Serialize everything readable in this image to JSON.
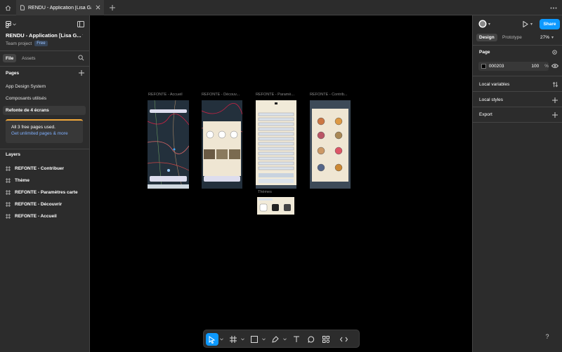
{
  "colors": {
    "accent": "#0d99ff",
    "panel": "#2c2c2c",
    "canvas": "#000000",
    "upsell_bar": "#f2a93b",
    "link": "#7fb0ff"
  },
  "tab": {
    "title": "RENDU - Application [Lisa Gadea]"
  },
  "left_panel": {
    "project_title": "RENDU - Application [Lisa G...",
    "team": "Team project",
    "plan_badge": "Free",
    "tabs": {
      "file": "File",
      "assets": "Assets"
    },
    "pages_heading": "Pages",
    "pages": [
      {
        "label": "App Design System"
      },
      {
        "label": "Composants utilisés"
      },
      {
        "label": "Refonte de 4 écrans"
      }
    ],
    "upsell": {
      "line1": "All 3 free pages used.",
      "line2": "Get unlimited pages & more"
    },
    "layers_heading": "Layers",
    "layers": [
      {
        "label": "REFONTE - Contribuer"
      },
      {
        "label": "Thème"
      },
      {
        "label": "REFONTE - Paramètres carte"
      },
      {
        "label": "REFONTE - Découvrir"
      },
      {
        "label": "REFONTE - Accueil"
      }
    ]
  },
  "right_panel": {
    "share": "Share",
    "tabs": {
      "design": "Design",
      "prototype": "Prototype"
    },
    "zoom": "27%",
    "page_heading": "Page",
    "page_color": {
      "hex": "000203",
      "opacity": "100",
      "unit": "%"
    },
    "local_variables": "Local variables",
    "local_styles": "Local styles",
    "export": "Export"
  },
  "canvas": {
    "frames": [
      {
        "label": "REFONTE - Accueil"
      },
      {
        "label": "REFONTE - Découv..."
      },
      {
        "label": "REFONTE - Paramè..."
      },
      {
        "label": "REFONTE - Contrib..."
      },
      {
        "label": "Thèmes"
      }
    ]
  }
}
